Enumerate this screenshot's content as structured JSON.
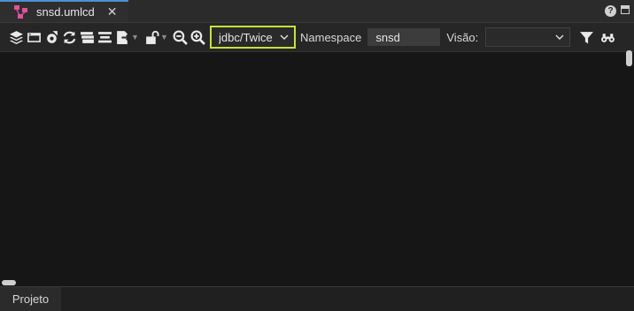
{
  "tab": {
    "label": "snsd.umlcd",
    "close": "✕",
    "icon_color": "#e0529c"
  },
  "help_label": "?",
  "toolbar": {
    "icons": [
      "layers-icon",
      "window-icon",
      "settings-refresh-icon",
      "refresh-icon",
      "cards-icon",
      "align-center-icon",
      "export-icon",
      "unlock-icon",
      "zoom-out-icon",
      "zoom-in-icon"
    ],
    "connection_value": "jdbc/Twice",
    "namespace_label": "Namespace",
    "namespace_value": "snsd",
    "view_label": "Visão:",
    "view_value": "",
    "highlight_color": "#c7e23a"
  },
  "bottom_tab": {
    "label": "Projeto"
  }
}
